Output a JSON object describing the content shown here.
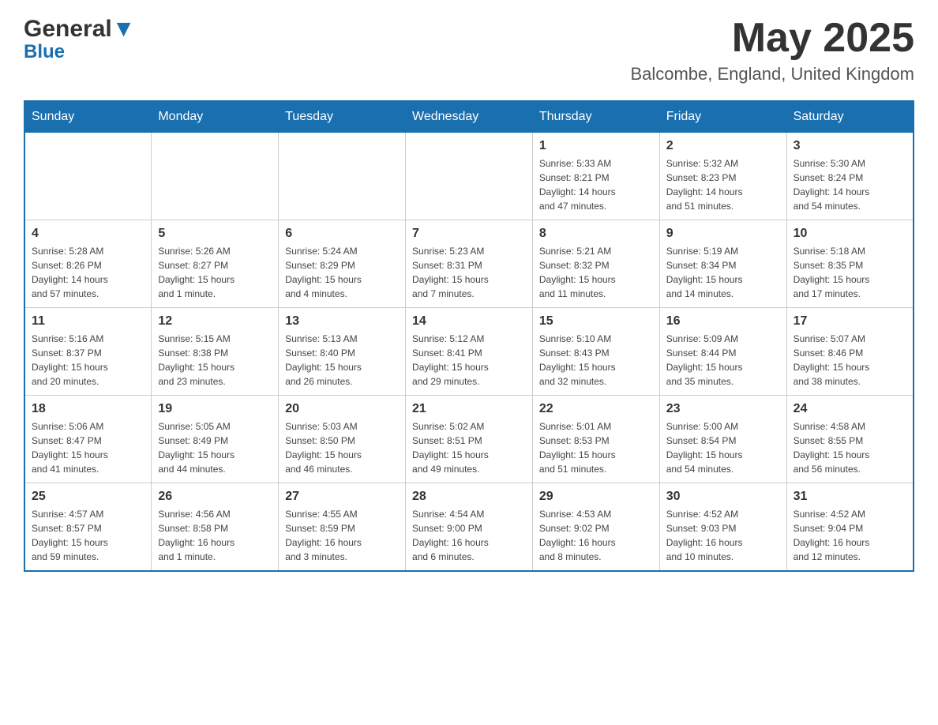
{
  "header": {
    "month_title": "May 2025",
    "location": "Balcombe, England, United Kingdom",
    "logo_general": "General",
    "logo_blue": "Blue"
  },
  "days_of_week": [
    "Sunday",
    "Monday",
    "Tuesday",
    "Wednesday",
    "Thursday",
    "Friday",
    "Saturday"
  ],
  "weeks": [
    [
      {
        "day": "",
        "info": ""
      },
      {
        "day": "",
        "info": ""
      },
      {
        "day": "",
        "info": ""
      },
      {
        "day": "",
        "info": ""
      },
      {
        "day": "1",
        "info": "Sunrise: 5:33 AM\nSunset: 8:21 PM\nDaylight: 14 hours\nand 47 minutes."
      },
      {
        "day": "2",
        "info": "Sunrise: 5:32 AM\nSunset: 8:23 PM\nDaylight: 14 hours\nand 51 minutes."
      },
      {
        "day": "3",
        "info": "Sunrise: 5:30 AM\nSunset: 8:24 PM\nDaylight: 14 hours\nand 54 minutes."
      }
    ],
    [
      {
        "day": "4",
        "info": "Sunrise: 5:28 AM\nSunset: 8:26 PM\nDaylight: 14 hours\nand 57 minutes."
      },
      {
        "day": "5",
        "info": "Sunrise: 5:26 AM\nSunset: 8:27 PM\nDaylight: 15 hours\nand 1 minute."
      },
      {
        "day": "6",
        "info": "Sunrise: 5:24 AM\nSunset: 8:29 PM\nDaylight: 15 hours\nand 4 minutes."
      },
      {
        "day": "7",
        "info": "Sunrise: 5:23 AM\nSunset: 8:31 PM\nDaylight: 15 hours\nand 7 minutes."
      },
      {
        "day": "8",
        "info": "Sunrise: 5:21 AM\nSunset: 8:32 PM\nDaylight: 15 hours\nand 11 minutes."
      },
      {
        "day": "9",
        "info": "Sunrise: 5:19 AM\nSunset: 8:34 PM\nDaylight: 15 hours\nand 14 minutes."
      },
      {
        "day": "10",
        "info": "Sunrise: 5:18 AM\nSunset: 8:35 PM\nDaylight: 15 hours\nand 17 minutes."
      }
    ],
    [
      {
        "day": "11",
        "info": "Sunrise: 5:16 AM\nSunset: 8:37 PM\nDaylight: 15 hours\nand 20 minutes."
      },
      {
        "day": "12",
        "info": "Sunrise: 5:15 AM\nSunset: 8:38 PM\nDaylight: 15 hours\nand 23 minutes."
      },
      {
        "day": "13",
        "info": "Sunrise: 5:13 AM\nSunset: 8:40 PM\nDaylight: 15 hours\nand 26 minutes."
      },
      {
        "day": "14",
        "info": "Sunrise: 5:12 AM\nSunset: 8:41 PM\nDaylight: 15 hours\nand 29 minutes."
      },
      {
        "day": "15",
        "info": "Sunrise: 5:10 AM\nSunset: 8:43 PM\nDaylight: 15 hours\nand 32 minutes."
      },
      {
        "day": "16",
        "info": "Sunrise: 5:09 AM\nSunset: 8:44 PM\nDaylight: 15 hours\nand 35 minutes."
      },
      {
        "day": "17",
        "info": "Sunrise: 5:07 AM\nSunset: 8:46 PM\nDaylight: 15 hours\nand 38 minutes."
      }
    ],
    [
      {
        "day": "18",
        "info": "Sunrise: 5:06 AM\nSunset: 8:47 PM\nDaylight: 15 hours\nand 41 minutes."
      },
      {
        "day": "19",
        "info": "Sunrise: 5:05 AM\nSunset: 8:49 PM\nDaylight: 15 hours\nand 44 minutes."
      },
      {
        "day": "20",
        "info": "Sunrise: 5:03 AM\nSunset: 8:50 PM\nDaylight: 15 hours\nand 46 minutes."
      },
      {
        "day": "21",
        "info": "Sunrise: 5:02 AM\nSunset: 8:51 PM\nDaylight: 15 hours\nand 49 minutes."
      },
      {
        "day": "22",
        "info": "Sunrise: 5:01 AM\nSunset: 8:53 PM\nDaylight: 15 hours\nand 51 minutes."
      },
      {
        "day": "23",
        "info": "Sunrise: 5:00 AM\nSunset: 8:54 PM\nDaylight: 15 hours\nand 54 minutes."
      },
      {
        "day": "24",
        "info": "Sunrise: 4:58 AM\nSunset: 8:55 PM\nDaylight: 15 hours\nand 56 minutes."
      }
    ],
    [
      {
        "day": "25",
        "info": "Sunrise: 4:57 AM\nSunset: 8:57 PM\nDaylight: 15 hours\nand 59 minutes."
      },
      {
        "day": "26",
        "info": "Sunrise: 4:56 AM\nSunset: 8:58 PM\nDaylight: 16 hours\nand 1 minute."
      },
      {
        "day": "27",
        "info": "Sunrise: 4:55 AM\nSunset: 8:59 PM\nDaylight: 16 hours\nand 3 minutes."
      },
      {
        "day": "28",
        "info": "Sunrise: 4:54 AM\nSunset: 9:00 PM\nDaylight: 16 hours\nand 6 minutes."
      },
      {
        "day": "29",
        "info": "Sunrise: 4:53 AM\nSunset: 9:02 PM\nDaylight: 16 hours\nand 8 minutes."
      },
      {
        "day": "30",
        "info": "Sunrise: 4:52 AM\nSunset: 9:03 PM\nDaylight: 16 hours\nand 10 minutes."
      },
      {
        "day": "31",
        "info": "Sunrise: 4:52 AM\nSunset: 9:04 PM\nDaylight: 16 hours\nand 12 minutes."
      }
    ]
  ]
}
